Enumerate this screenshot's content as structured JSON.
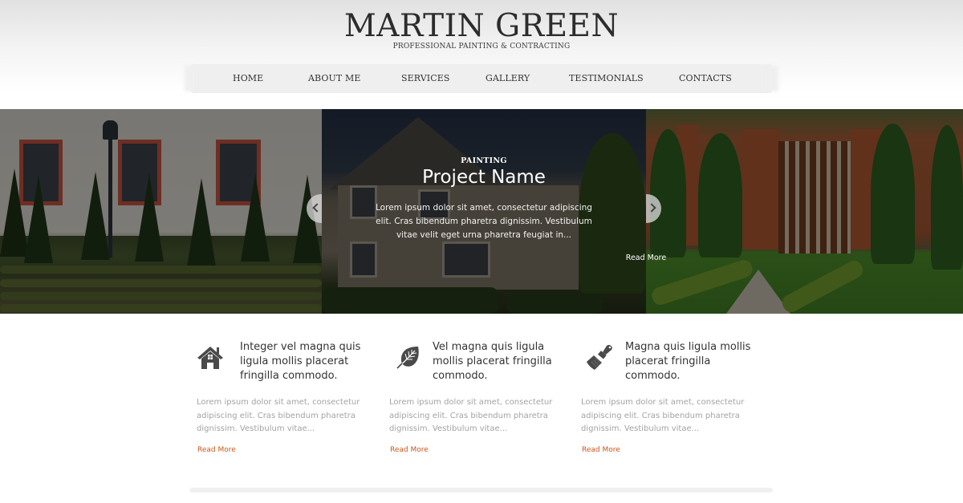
{
  "header": {
    "title": "MARTIN GREEN",
    "subtitle": "PROFESSIONAL PAINTING & CONTRACTING"
  },
  "nav": {
    "items": [
      {
        "label": "HOME"
      },
      {
        "label": "ABOUT ME"
      },
      {
        "label": "SERVICES"
      },
      {
        "label": "GALLERY"
      },
      {
        "label": "TESTIMONIALS"
      },
      {
        "label": "CONTACTS"
      }
    ]
  },
  "slider": {
    "category": "PAINTING",
    "title": "Project Name",
    "text": "Lorem ipsum dolor sit amet, consectetur adipiscing elit. Cras bibendum pharetra dignissim. Vestibulum vitae velit eget urna pharetra feugiat in...",
    "read_more": "Read More",
    "prev_icon": "chevron-left-icon",
    "next_icon": "chevron-right-icon"
  },
  "features": [
    {
      "icon": "house-icon",
      "title": "Integer vel magna quis ligula mollis placerat fringilla  commodo.",
      "text": "Lorem ipsum dolor sit amet, consectetur adipiscing elit. Cras bibendum pharetra dignissim. Vestibulum vitae...",
      "read_more": "Read More"
    },
    {
      "icon": "leaf-icon",
      "title": "Vel magna quis ligula mollis placerat fringilla commodo.",
      "text": "Lorem ipsum dolor sit amet, consectetur adipiscing elit. Cras bibendum pharetra dignissim. Vestibulum vitae...",
      "read_more": "Read More"
    },
    {
      "icon": "paintbrush-icon",
      "title": "Magna quis ligula mollis placerat fringilla commodo.",
      "text": "Lorem ipsum dolor sit amet, consectetur adipiscing elit. Cras bibendum pharetra dignissim. Vestibulum vitae...",
      "read_more": "Read More"
    }
  ],
  "colors": {
    "accent": "#c9561e",
    "text_dark": "#333333",
    "text_muted": "#a3a3a3",
    "nav_bg": "#efefef"
  }
}
